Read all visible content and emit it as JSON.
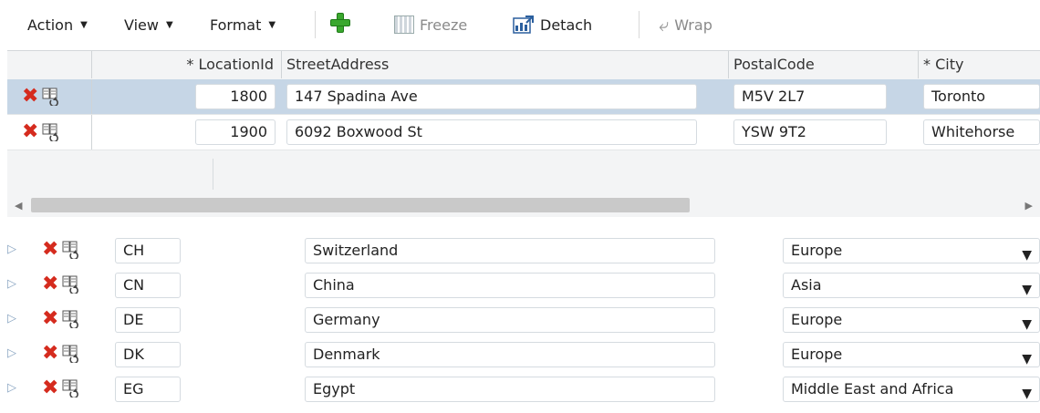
{
  "toolbar": {
    "action_label": "Action",
    "view_label": "View",
    "format_label": "Format",
    "freeze_label": "Freeze",
    "detach_label": "Detach",
    "wrap_label": "Wrap",
    "caret": "▼"
  },
  "top_table": {
    "headers": [
      "* LocationId",
      "StreetAddress",
      "PostalCode",
      "* City"
    ],
    "rows": [
      {
        "location_id": "1800",
        "street": "147 Spadina Ave",
        "postal": "M5V 2L7",
        "city": "Toronto",
        "selected": true
      },
      {
        "location_id": "1900",
        "street": "6092 Boxwood St",
        "postal": "YSW 9T2",
        "city": "Whitehorse",
        "selected": false
      }
    ]
  },
  "bottom_table": {
    "rows": [
      {
        "code": "CH",
        "name": "Switzerland",
        "region": "Europe"
      },
      {
        "code": "CN",
        "name": "China",
        "region": "Asia"
      },
      {
        "code": "DE",
        "name": "Germany",
        "region": "Europe"
      },
      {
        "code": "DK",
        "name": "Denmark",
        "region": "Europe"
      },
      {
        "code": "EG",
        "name": "Egypt",
        "region": "Middle East and Africa"
      }
    ]
  },
  "icons": {
    "delete": "delete-x-icon",
    "row_action": "row-properties-icon",
    "expand": "expand-triangle-icon",
    "dropdown": "dropdown-arrow-icon"
  },
  "colors": {
    "selected_row": "#c6d6e6",
    "delete_icon": "#d52b1e",
    "add_icon": "#3aa82e"
  }
}
